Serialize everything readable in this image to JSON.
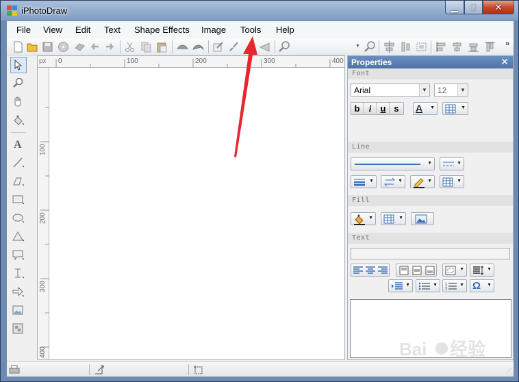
{
  "window": {
    "title": "iPhotoDraw",
    "controls": {
      "minimize": "▁",
      "maximize": "□",
      "close": "✕"
    }
  },
  "menu": {
    "items": [
      "File",
      "View",
      "Edit",
      "Text",
      "Shape Effects",
      "Image",
      "Tools",
      "Help"
    ]
  },
  "toolbar": {
    "icons": [
      "new-icon",
      "open-icon",
      "save-icon",
      "disc-icon",
      "export-icon",
      "undo-icon",
      "redo-icon",
      "cut-icon",
      "copy-icon",
      "paste-icon",
      "group-icon",
      "ungroup-icon",
      "edit-icon",
      "brush-icon",
      "eraser-icon",
      "triangle-icon",
      "zoom-icon",
      "zoom-fit-icon",
      "align-center-icon",
      "distribute-icon",
      "align-left-icon",
      "align-top-icon",
      "align-bottom-icon"
    ],
    "overflow": "»"
  },
  "left_tools": [
    "select",
    "zoom",
    "pan",
    "fill",
    "text",
    "line",
    "polygon",
    "rectangle",
    "ellipse",
    "triangle",
    "callout",
    "dimension",
    "arrow",
    "image",
    "mosaic"
  ],
  "ruler": {
    "unit": "px",
    "h_labels": [
      "0",
      "100",
      "200",
      "300",
      "400"
    ],
    "v_labels": [
      "100",
      "200",
      "300",
      "400"
    ]
  },
  "properties": {
    "title": "Properties",
    "close": "✕",
    "sections": {
      "font": "Font",
      "line": "Line",
      "fill": "Fill",
      "text": "Text"
    },
    "font_family": "Arial",
    "font_size": "12",
    "format_buttons": [
      "b",
      "i",
      "u",
      "s"
    ],
    "font_color_glyph": "A",
    "text_value": ""
  },
  "colors": {
    "accent": "#4d73a8",
    "annotation_arrow": "#e8262d"
  }
}
